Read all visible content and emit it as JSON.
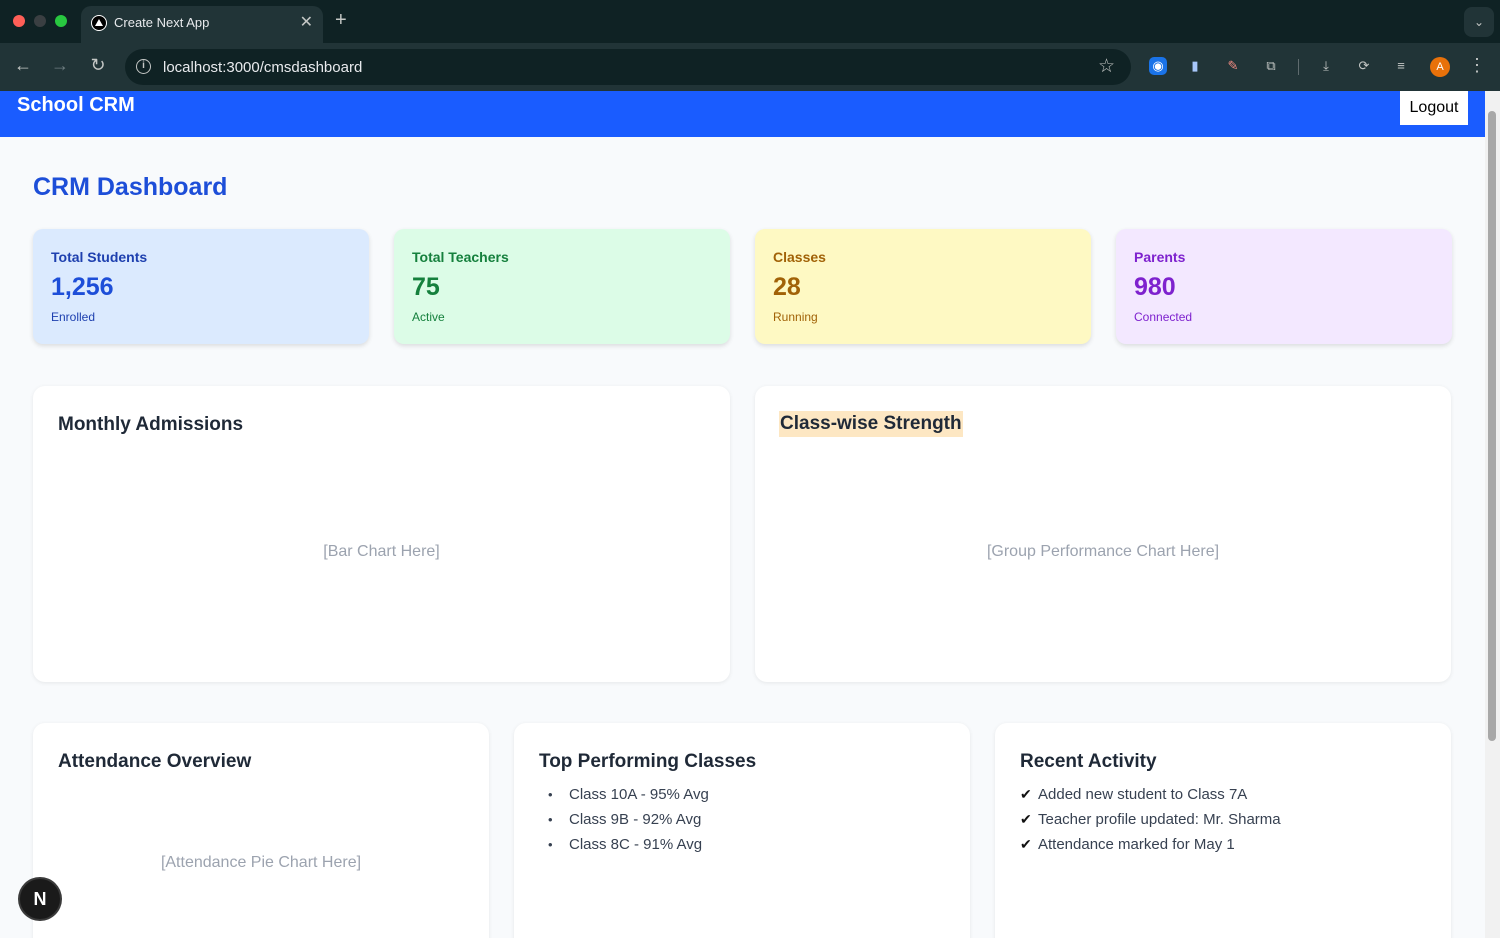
{
  "browser": {
    "tab_title": "Create Next App",
    "url": "localhost:3000/cmsdashboard",
    "avatar_initial": "A"
  },
  "header": {
    "brand": "School CRM",
    "logout_label": "Logout",
    "bg_color": "#1a5cff"
  },
  "page": {
    "title": "CRM Dashboard"
  },
  "stats": [
    {
      "label": "Total Students",
      "value": "1,256",
      "sub": "Enrolled",
      "color": "#1d4ed8"
    },
    {
      "label": "Total Teachers",
      "value": "75",
      "sub": "Active",
      "color": "#15803d"
    },
    {
      "label": "Classes",
      "value": "28",
      "sub": "Running",
      "color": "#a16207"
    },
    {
      "label": "Parents",
      "value": "980",
      "sub": "Connected",
      "color": "#7e22ce"
    }
  ],
  "cards": {
    "monthly_admissions": {
      "title": "Monthly Admissions",
      "placeholder": "[Bar Chart Here]"
    },
    "class_strength": {
      "title": "Class-wise Strength",
      "placeholder": "[Group Performance Chart Here]"
    },
    "attendance": {
      "title": "Attendance Overview",
      "placeholder": "[Attendance Pie Chart Here]"
    },
    "top_classes": {
      "title": "Top Performing Classes",
      "items": [
        "Class 10A - 95% Avg",
        "Class 9B - 92% Avg",
        "Class 8C - 91% Avg"
      ]
    },
    "recent_activity": {
      "title": "Recent Activity",
      "items": [
        "Added new student to Class 7A",
        "Teacher profile updated: Mr. Sharma",
        "Attendance marked for May 1"
      ]
    }
  },
  "next_badge": "N"
}
